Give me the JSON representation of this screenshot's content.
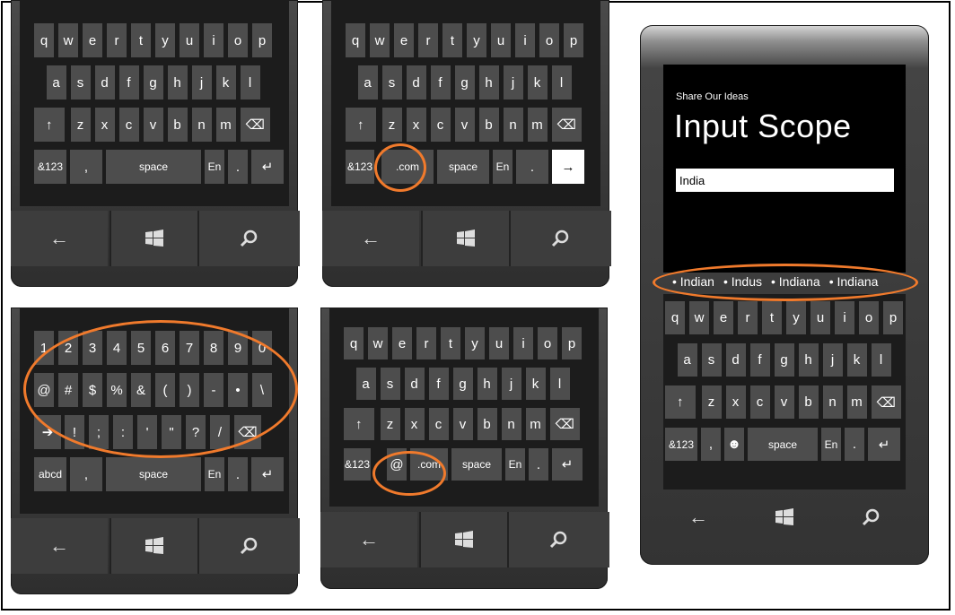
{
  "accent_color": "#f07a2c",
  "panel_letters": {
    "row1": [
      "q",
      "w",
      "e",
      "r",
      "t",
      "y",
      "u",
      "i",
      "o",
      "p"
    ],
    "row2": [
      "a",
      "s",
      "d",
      "f",
      "g",
      "h",
      "j",
      "k",
      "l"
    ],
    "row3": [
      "↑",
      "z",
      "x",
      "c",
      "v",
      "b",
      "n",
      "m",
      "⌫"
    ],
    "bottom": {
      "sym": "&123",
      "comma": ",",
      "space": "space",
      "lang": "En",
      "dot": ".",
      "enter": "↵"
    }
  },
  "panel_url": {
    "bottom": {
      "sym": "&123",
      "com": ".com",
      "space": "space",
      "lang": "En",
      "dot": ".",
      "go": "→"
    }
  },
  "panel_symbols": {
    "row1": [
      "1",
      "2",
      "3",
      "4",
      "5",
      "6",
      "7",
      "8",
      "9",
      "0"
    ],
    "row2": [
      "@",
      "#",
      "$",
      "%",
      "&",
      "(",
      ")",
      "-",
      "•",
      "\\"
    ],
    "row3": [
      "➔",
      "!",
      ";",
      ":",
      "'",
      "\"",
      "?",
      "/",
      "⌫"
    ],
    "bottom": {
      "abc": "abcd",
      "comma": ",",
      "space": "space",
      "lang": "En",
      "dot": ".",
      "enter": "↵"
    }
  },
  "panel_email": {
    "bottom": {
      "sym": "&123",
      "at": "@",
      "com": ".com",
      "space": "space",
      "lang": "En",
      "dot": ".",
      "enter": "↵"
    }
  },
  "app": {
    "subtitle": "Share Our Ideas",
    "title": "Input Scope",
    "input_value": "India",
    "suggestions": [
      "Indian",
      "Indus",
      "Indiana",
      "Indiana"
    ],
    "bottom": {
      "sym": "&123",
      "comma": ",",
      "emoji": "☻",
      "space": "space",
      "lang": "En",
      "dot": ".",
      "enter": "↵"
    }
  },
  "nav": {
    "back": "back-icon",
    "start": "windows-icon",
    "search": "search-icon"
  }
}
